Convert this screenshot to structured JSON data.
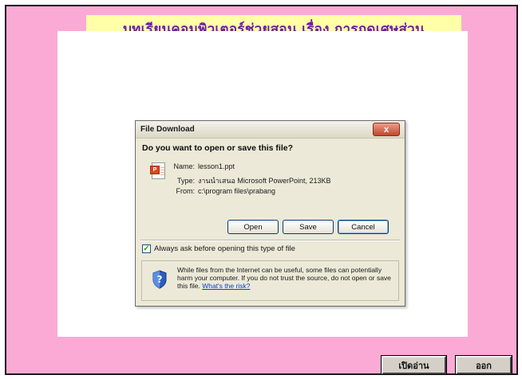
{
  "page": {
    "title": "บทเรียนคอมพิวเตอร์ช่วยสอน เรื่อง การถูดเศษส่วน"
  },
  "dialog": {
    "title": "File Download",
    "close_label": "x",
    "question": "Do you want to open or save this file?",
    "file_icon": "powerpoint-file-icon",
    "name_key": "Name:",
    "name_value": "lesson1.ppt",
    "type_key": "Type:",
    "type_value": "งานนำเสนอ Microsoft PowerPoint, 213KB",
    "from_key": "From:",
    "from_value": "c:\\program files\\prabang",
    "open_label": "Open",
    "save_label": "Save",
    "cancel_label": "Cancel",
    "checkbox_checked": true,
    "checkbox_label": "Always ask before opening this type of file",
    "warning_icon": "shield-question-icon",
    "warning_text": "While files from the Internet can be useful, some files can potentially harm your computer. If you do not trust the source, do not open or save this file.",
    "warning_link": "What's the risk?"
  },
  "nav": {
    "open_label": "เปิดอ่าน",
    "exit_label": "ออก"
  },
  "colors": {
    "background": "#fbaad6",
    "title_bar": "#ffffa8",
    "title_text": "#6a1aa8"
  }
}
